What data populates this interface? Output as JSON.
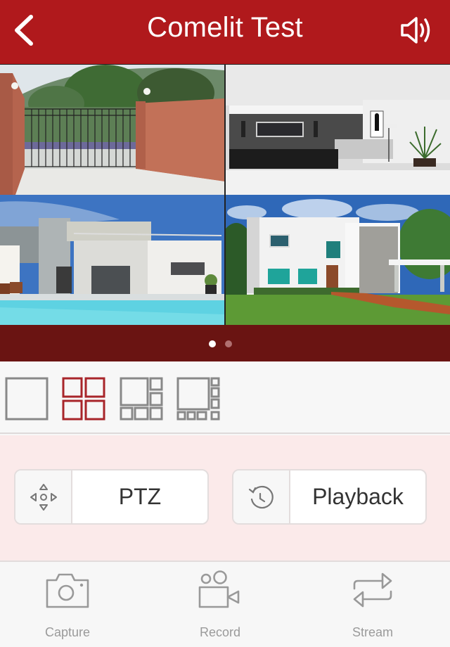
{
  "header": {
    "title": "Comelit Test",
    "back_icon": "chevron-left-icon",
    "sound_icon": "speaker-volume-icon",
    "background_color": "#b0191c"
  },
  "cameras": [
    {
      "name": "Gate",
      "description": "brick walls with black iron sliding gate, trees and hills behind"
    },
    {
      "name": "Living room",
      "description": "modern interior with dark wallpaper wall, TV, sofa, floor lamp and potted palm"
    },
    {
      "name": "Pool",
      "description": "white modern house with terrace railing and blue swimming pool"
    },
    {
      "name": "Garden",
      "description": "white cubic house with green lawn, teal windows and trees under blue sky"
    }
  ],
  "pager": {
    "pages": 2,
    "current_page": 1,
    "active_color": "#ffffff",
    "inactive_color": "#b07070",
    "background_color": "#6a1412"
  },
  "layouts": {
    "options": [
      "single-view",
      "quad-view",
      "six-view",
      "eight-view"
    ],
    "selected": "quad-view",
    "selected_color": "#a8252a",
    "unselected_color": "#888888"
  },
  "controls": {
    "ptz": {
      "label": "PTZ",
      "icon": "ptz-directional-icon"
    },
    "playback": {
      "label": "Playback",
      "icon": "history-clock-icon"
    }
  },
  "toolbar": {
    "items": [
      {
        "label": "Capture",
        "icon": "camera-icon"
      },
      {
        "label": "Record",
        "icon": "video-camera-icon"
      },
      {
        "label": "Stream",
        "icon": "swap-arrows-icon"
      }
    ]
  }
}
